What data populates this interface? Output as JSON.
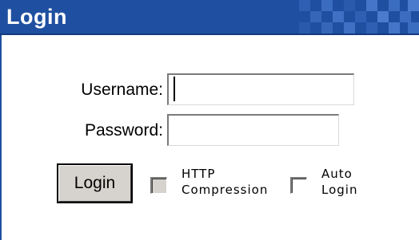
{
  "header": {
    "title": "Login"
  },
  "form": {
    "username_label": "Username:",
    "username_value": "",
    "password_label": "Password:",
    "password_value": "",
    "login_button": "Login",
    "http_compression_line1": "HTTP",
    "http_compression_line2": "Compression",
    "http_compression_checked": false,
    "http_compression_enabled": false,
    "auto_login_line1": "Auto",
    "auto_login_line2": "Login",
    "auto_login_checked": false
  },
  "colors": {
    "titlebar": "#1f4fa0",
    "button_face": "#d6d3ce",
    "background": "#ffffff"
  }
}
